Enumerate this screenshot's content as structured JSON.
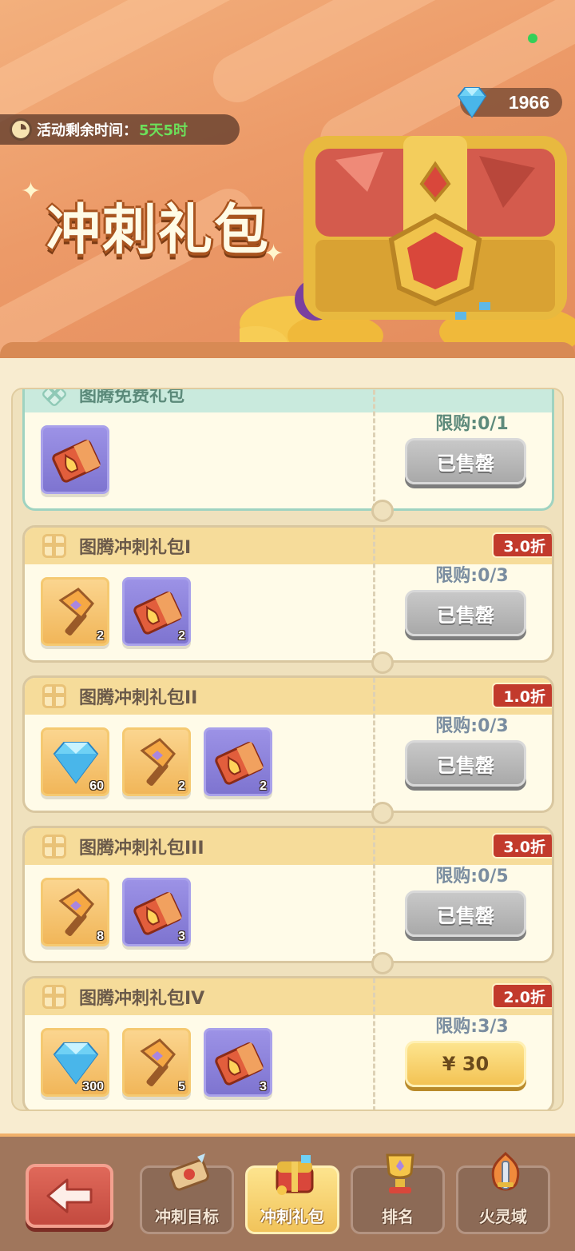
{
  "header": {
    "gem_count": "1966",
    "timer_label": "活动剩余时间：",
    "timer_value": "5天5时",
    "title": "冲刺礼包"
  },
  "packs": [
    {
      "title": "图腾免费礼包",
      "discount": "",
      "limit": "限购:0/1",
      "button": "已售罄",
      "state": "soldout",
      "items": [
        {
          "icon": "ticket-icon",
          "type": "purple",
          "qty": ""
        }
      ]
    },
    {
      "title": "图腾冲刺礼包I",
      "discount": "3.0折",
      "limit": "限购:0/3",
      "button": "已售罄",
      "state": "soldout",
      "items": [
        {
          "icon": "hammer-icon",
          "type": "gold",
          "qty": "2"
        },
        {
          "icon": "ticket-icon",
          "type": "purple",
          "qty": "2"
        }
      ]
    },
    {
      "title": "图腾冲刺礼包II",
      "discount": "1.0折",
      "limit": "限购:0/3",
      "button": "已售罄",
      "state": "soldout",
      "items": [
        {
          "icon": "diamond-icon",
          "type": "gold",
          "qty": "60"
        },
        {
          "icon": "hammer-icon",
          "type": "gold",
          "qty": "2"
        },
        {
          "icon": "ticket-icon",
          "type": "purple",
          "qty": "2"
        }
      ]
    },
    {
      "title": "图腾冲刺礼包III",
      "discount": "3.0折",
      "limit": "限购:0/5",
      "button": "已售罄",
      "state": "soldout",
      "items": [
        {
          "icon": "hammer-icon",
          "type": "gold",
          "qty": "8"
        },
        {
          "icon": "ticket-icon",
          "type": "purple",
          "qty": "3"
        }
      ]
    },
    {
      "title": "图腾冲刺礼包IV",
      "discount": "2.0折",
      "limit": "限购:3/3",
      "button": "¥ 30",
      "state": "price",
      "items": [
        {
          "icon": "diamond-icon",
          "type": "gold",
          "qty": "300"
        },
        {
          "icon": "hammer-icon",
          "type": "gold",
          "qty": "5"
        },
        {
          "icon": "ticket-icon",
          "type": "purple",
          "qty": "3"
        }
      ]
    }
  ],
  "nav": {
    "back_icon": "arrow-left-icon",
    "tabs": [
      {
        "label": "冲刺目标",
        "icon": "scroll-icon",
        "active": false
      },
      {
        "label": "冲刺礼包",
        "icon": "treasure-chest-icon",
        "active": true
      },
      {
        "label": "排名",
        "icon": "trophy-icon",
        "active": false
      },
      {
        "label": "火灵域",
        "icon": "fire-sword-icon",
        "active": false
      }
    ]
  },
  "colors": {
    "banner": "#ec9a68",
    "discount": "#c23a2c",
    "timer_value": "#6de05a",
    "soldout_button": "#a9a9a9",
    "price_button": "#f3c354"
  }
}
